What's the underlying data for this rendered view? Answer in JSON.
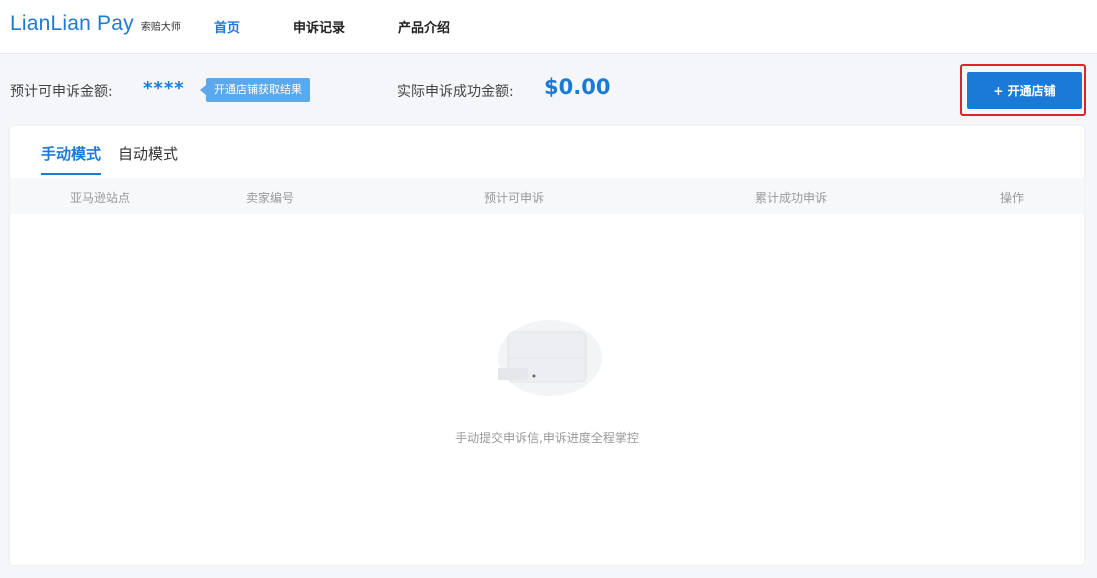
{
  "header": {
    "logo_main": "LianLian Pay",
    "logo_sub": "索赔大师",
    "nav": [
      {
        "label": "首页",
        "active": true
      },
      {
        "label": "申诉记录",
        "active": false
      },
      {
        "label": "产品介绍",
        "active": false
      }
    ]
  },
  "summary": {
    "estimated_label": "预计可申诉金额:",
    "estimated_value": "****",
    "hint": "开通店铺获取结果",
    "actual_label": "实际申诉成功金额:",
    "actual_value": "$0.00",
    "open_shop_button": "+ 开通店铺"
  },
  "tabs": [
    {
      "label": "手动模式",
      "active": true
    },
    {
      "label": "自动模式",
      "active": false
    }
  ],
  "table": {
    "columns": [
      "亚马逊站点",
      "卖家编号",
      "预计可申诉",
      "累计成功申诉",
      "操作"
    ]
  },
  "empty_state": {
    "message": "手动提交申诉信,申诉进度全程掌控"
  },
  "colors": {
    "accent": "#1c7ad7",
    "highlight": "#d9262c"
  }
}
